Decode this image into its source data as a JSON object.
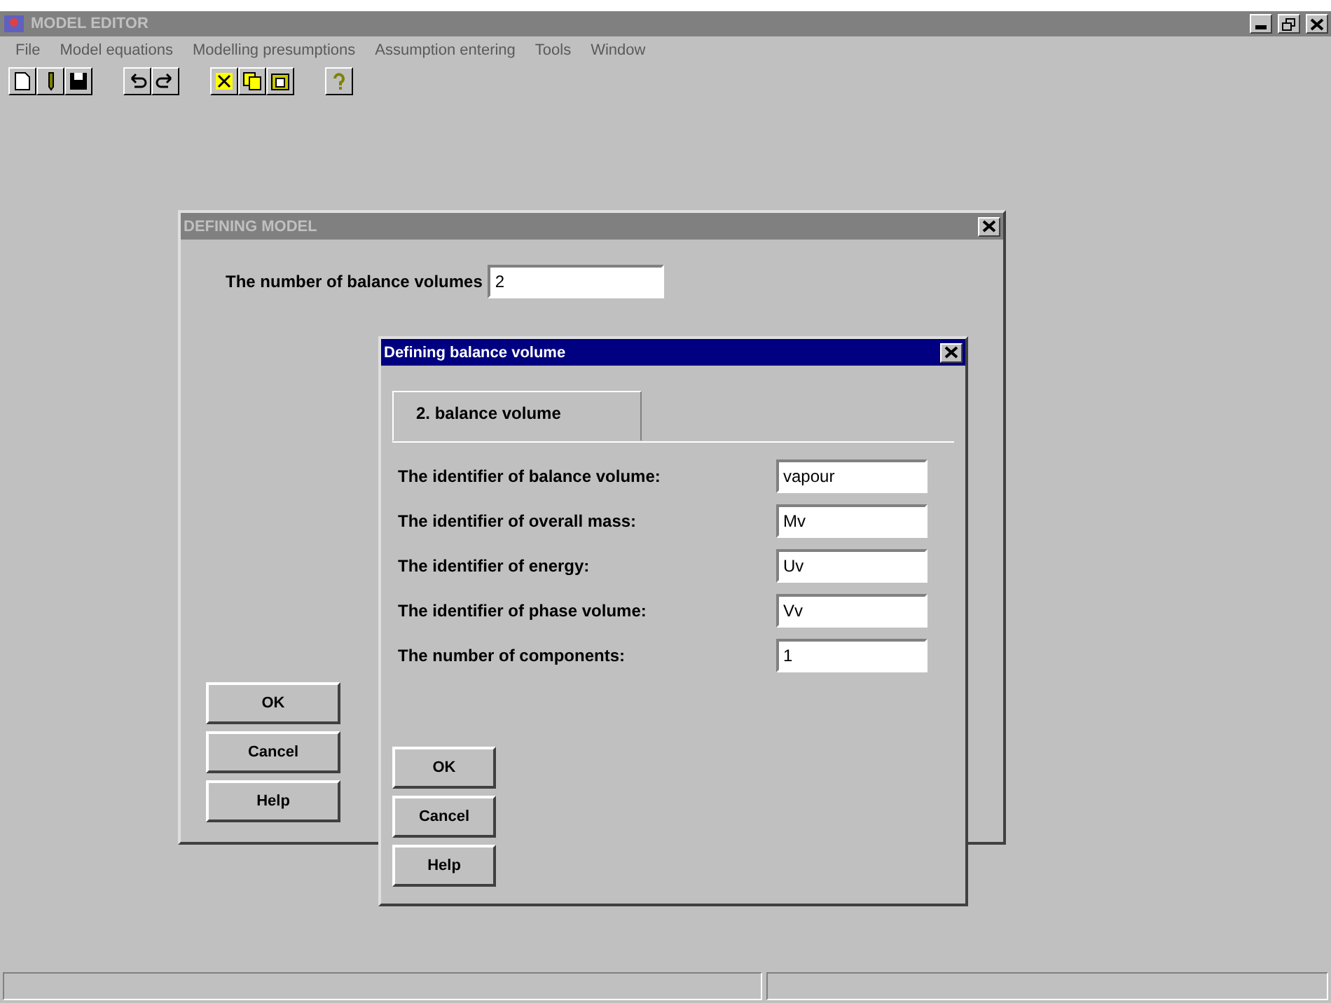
{
  "window": {
    "title": "MODEL EDITOR",
    "active": false
  },
  "menu": [
    {
      "label": "File"
    },
    {
      "label": "Model equations"
    },
    {
      "label": "Modelling presumptions"
    },
    {
      "label": "Assumption entering"
    },
    {
      "label": "Tools"
    },
    {
      "label": "Window"
    }
  ],
  "dialogs": [
    {
      "title": "DEFINING MODEL",
      "active": false,
      "fields": [
        {
          "label": "The number of balance volumes",
          "value": "2"
        }
      ],
      "buttons": [
        "OK",
        "Cancel",
        "Help"
      ]
    },
    {
      "title": "Defining balance volume",
      "active": true,
      "tabs": [
        {
          "label": "2. balance volume",
          "selected": true
        }
      ],
      "fields": [
        {
          "label": "The identifier of balance volume:",
          "value": "vapour"
        },
        {
          "label": "The identifier of overall mass:",
          "value": "Mv"
        },
        {
          "label": "The identifier of energy:",
          "value": "Uv"
        },
        {
          "label": "The identifier of phase volume:",
          "value": "Vv"
        },
        {
          "label": "The number of components:",
          "value": "1"
        }
      ],
      "buttons": [
        "OK",
        "Cancel",
        "Help"
      ]
    }
  ]
}
